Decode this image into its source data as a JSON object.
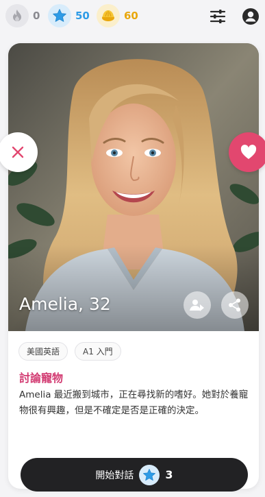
{
  "stats": {
    "flame_icon": "flame-icon",
    "flame_count": "0",
    "star_icon": "star-icon",
    "star_count": "50",
    "coin_icon": "coin-icon",
    "coin_count": "60"
  },
  "toolbar": {
    "filter_icon": "sliders-icon",
    "account_icon": "account-icon"
  },
  "profile": {
    "name_age": "Amelia, 32",
    "tags": [
      "美國英語",
      "A1 入門"
    ],
    "topic": "討論寵物",
    "bio": "Amelia 最近搬到城市，正在尋找新的嗜好。她對於養寵物很有興趣，但是不確定是否是正確的決定。"
  },
  "actions": {
    "dislike_icon": "close-icon",
    "like_icon": "heart-icon",
    "report_icon": "person-flag-icon",
    "share_icon": "share-icon"
  },
  "start_chat": {
    "label": "開始對話",
    "cost": "3"
  },
  "colors": {
    "accent_pink": "#d23a71",
    "like_red": "#e2476f",
    "star_blue": "#2e9be6",
    "coin_gold": "#e9a70c",
    "button_dark": "#222224"
  }
}
